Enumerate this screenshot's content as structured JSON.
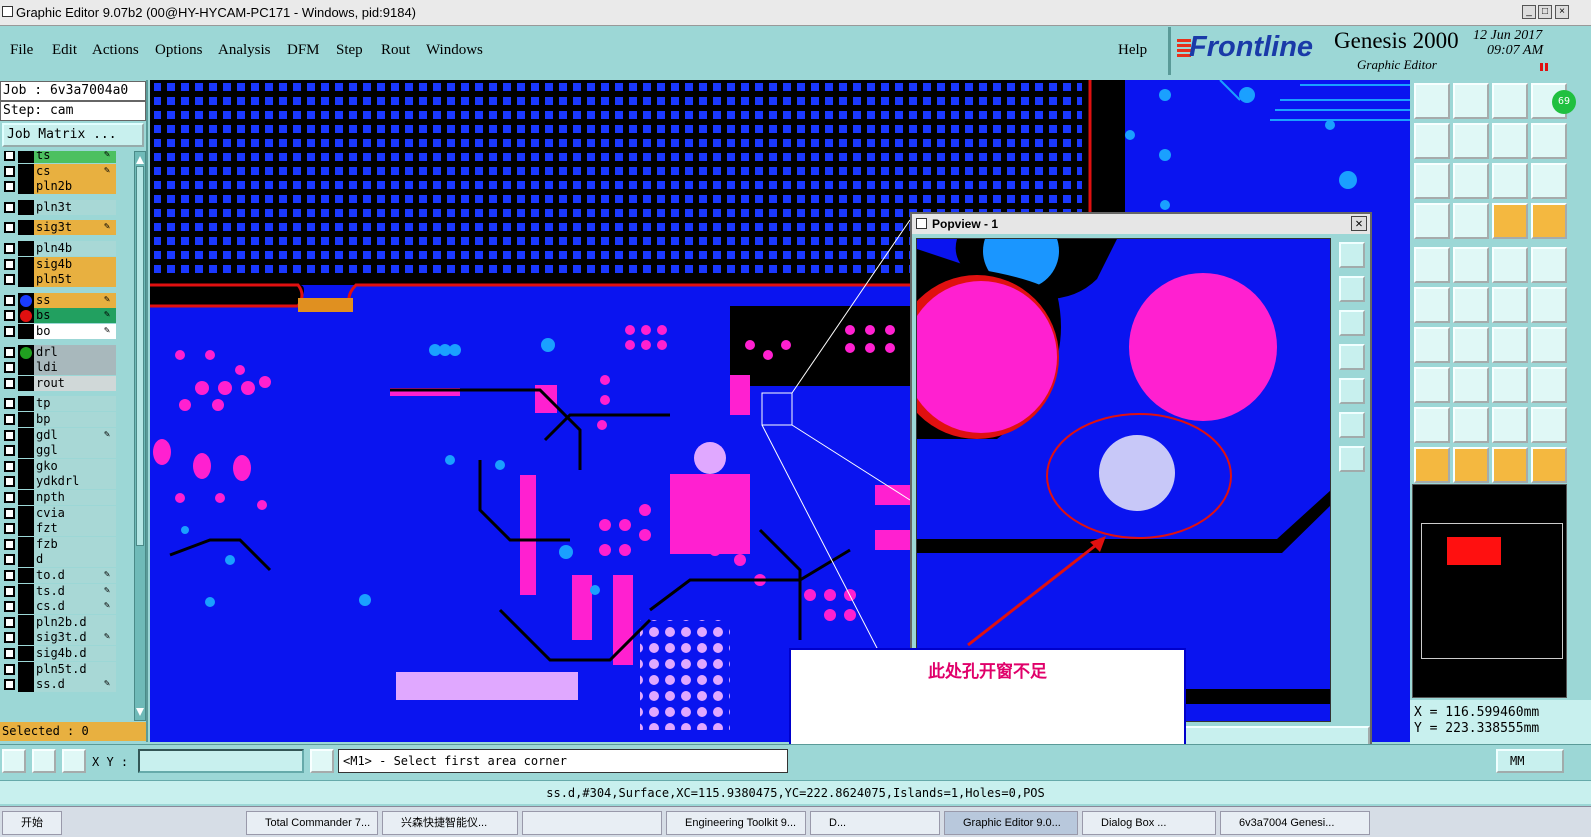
{
  "window": {
    "title": "Graphic Editor 9.07b2 (00@HY-HYCAM-PC171 - Windows, pid:9184)"
  },
  "menu": {
    "items": [
      "File",
      "Edit",
      "Actions",
      "Options",
      "Analysis",
      "DFM",
      "Step",
      "Rout",
      "Windows"
    ],
    "help": "Help"
  },
  "brand": {
    "vendor": "Frontline",
    "product": "Genesis 2000",
    "subtitle": "Graphic Editor",
    "date": "12 Jun 2017",
    "time": "09:07 AM",
    "badge": "69"
  },
  "job": {
    "job_label": "Job : 6v3a7004a0",
    "step_label": "Step: cam",
    "matrix_button": "Job Matrix ..."
  },
  "layers": [
    {
      "name": "ts",
      "color": "#4cc060",
      "flag": "✎"
    },
    {
      "name": "cs",
      "color": "#e8b040",
      "flag": "✎"
    },
    {
      "name": "pln2b",
      "color": "#e8b040",
      "flag": ""
    },
    {
      "name": "pln3t",
      "color": "#a8d8d6",
      "flag": ""
    },
    {
      "name": "sig3t",
      "color": "#e8b040",
      "flag": "✎"
    },
    {
      "name": "pln4b",
      "color": "#a8d8d6",
      "flag": ""
    },
    {
      "name": "sig4b",
      "color": "#e8b040",
      "flag": ""
    },
    {
      "name": "pln5t",
      "color": "#e8b040",
      "flag": ""
    },
    {
      "name": "ss",
      "color": "#e8b040",
      "flag": "✎",
      "dot": "#1a3cff"
    },
    {
      "name": "bs",
      "color": "#22a060",
      "flag": "✎",
      "dot": "#e01010"
    },
    {
      "name": "bo",
      "color": "#ffffff",
      "flag": "✎"
    },
    {
      "name": "drl",
      "color": "#a8b8bc",
      "flag": "",
      "dot": "#20a020"
    },
    {
      "name": "ldi",
      "color": "#a8b8bc",
      "flag": ""
    },
    {
      "name": "rout",
      "color": "#d0d8d8",
      "flag": ""
    },
    {
      "name": "tp",
      "color": "#a8d8d6",
      "flag": ""
    },
    {
      "name": "bp",
      "color": "#a8d8d6",
      "flag": ""
    },
    {
      "name": "gdl",
      "color": "#a8d8d6",
      "flag": "✎"
    },
    {
      "name": "ggl",
      "color": "#a8d8d6",
      "flag": ""
    },
    {
      "name": "gko",
      "color": "#a8d8d6",
      "flag": ""
    },
    {
      "name": "ydkdrl",
      "color": "#a8d8d6",
      "flag": ""
    },
    {
      "name": "npth",
      "color": "#a8d8d6",
      "flag": ""
    },
    {
      "name": "cvia",
      "color": "#a8d8d6",
      "flag": ""
    },
    {
      "name": "fzt",
      "color": "#a8d8d6",
      "flag": ""
    },
    {
      "name": "fzb",
      "color": "#a8d8d6",
      "flag": ""
    },
    {
      "name": "d",
      "color": "#a8d8d6",
      "flag": ""
    },
    {
      "name": "to.d",
      "color": "#a8d8d6",
      "flag": "✎"
    },
    {
      "name": "ts.d",
      "color": "#a8d8d6",
      "flag": "✎"
    },
    {
      "name": "cs.d",
      "color": "#a8d8d6",
      "flag": "✎"
    },
    {
      "name": "pln2b.d",
      "color": "#a8d8d6",
      "flag": ""
    },
    {
      "name": "sig3t.d",
      "color": "#a8d8d6",
      "flag": "✎"
    },
    {
      "name": "sig4b.d",
      "color": "#a8d8d6",
      "flag": ""
    },
    {
      "name": "pln5t.d",
      "color": "#a8d8d6",
      "flag": ""
    },
    {
      "name": "ss.d",
      "color": "#a8d8d6",
      "flag": "✎"
    }
  ],
  "selected": "Selected : 0",
  "popview": {
    "title": "Popview - 1",
    "close": "✕"
  },
  "annotation": {
    "text": "此处孔开窗不足"
  },
  "cursor": {
    "x_label": "X = 116.599460mm",
    "y_label": "Y = 223.338555mm"
  },
  "command": {
    "xy_label": "X Y :",
    "xy_value": "",
    "prompt": "<M1> - Select first area corner",
    "unit": "MM"
  },
  "status": {
    "text": "ss.d,#304,Surface,XC=115.9380475,YC=222.8624075,Islands=1,Holes=0,POS"
  },
  "taskbar": {
    "items": [
      "开始",
      "Total Commander 7...",
      "兴森快捷智能仪...",
      "",
      "Engineering Toolkit 9...",
      "D...",
      "Graphic Editor 9.0...",
      "Dialog Box ...",
      "6v3a7004 Genesi..."
    ]
  },
  "colors": {
    "board": "#0a14f0",
    "pad": "#ff20d0",
    "solder_open": "#e01010",
    "accent": "#9cd7d6"
  }
}
